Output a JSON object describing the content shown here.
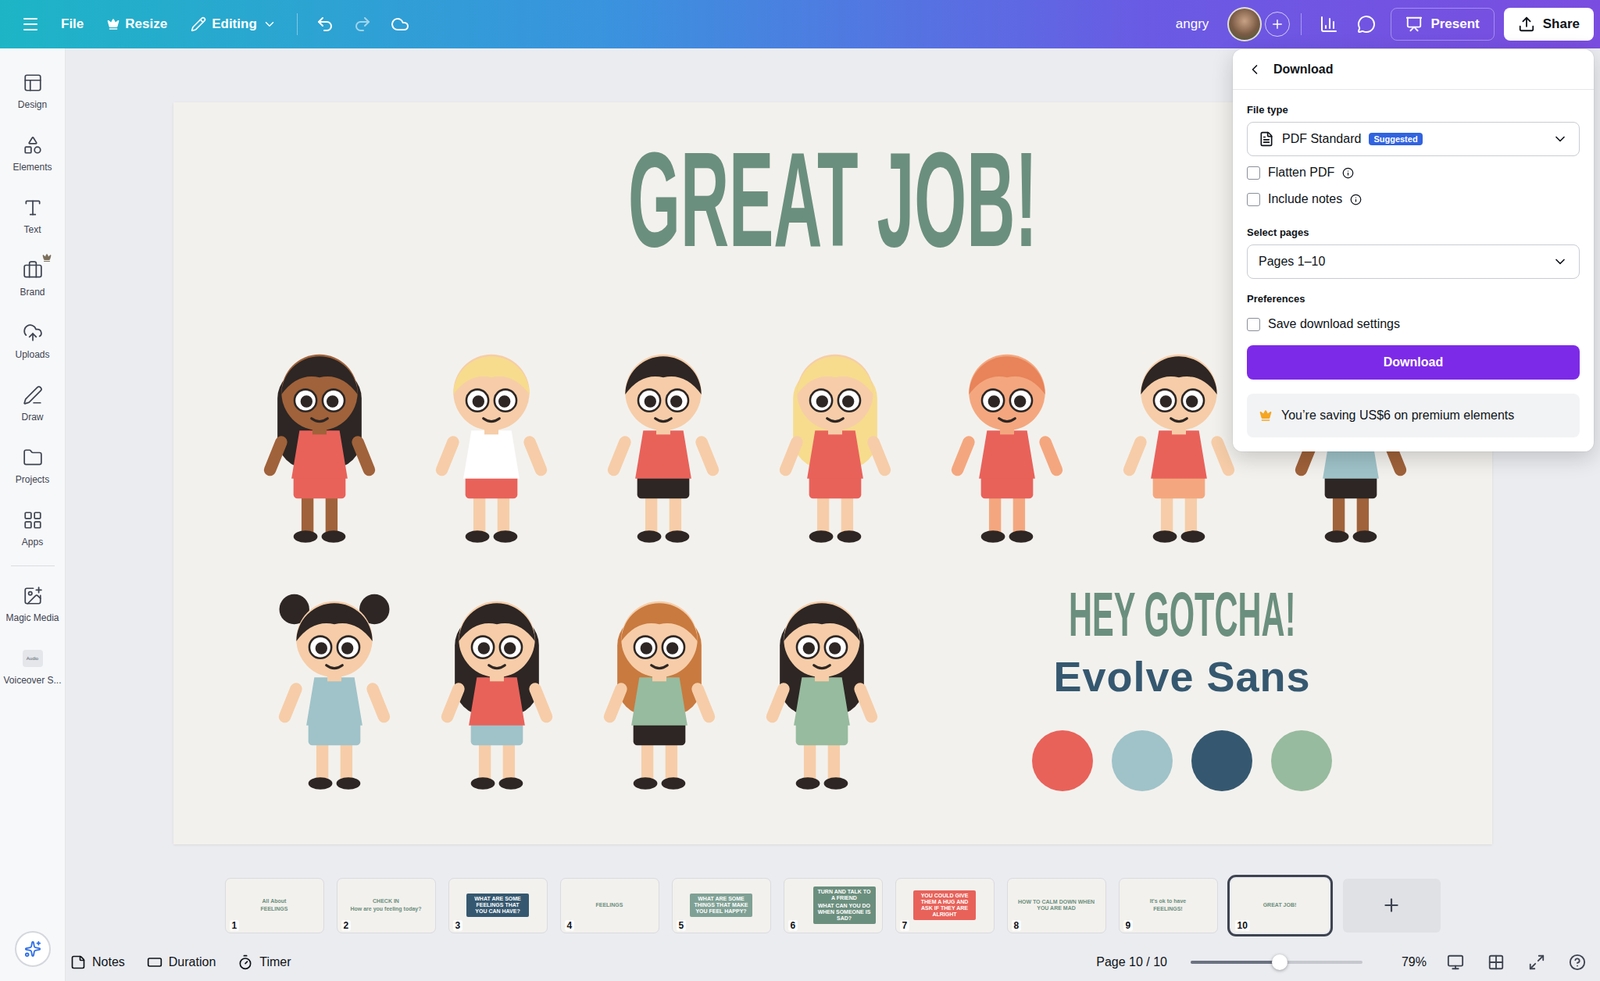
{
  "top_bar": {
    "file": "File",
    "resize": {
      "label": "Resize",
      "premium": true
    },
    "mode": "Editing",
    "title": "angry",
    "present": "Present",
    "share": "Share"
  },
  "sidebar": {
    "main": [
      {
        "label": "Design",
        "premium": false
      },
      {
        "label": "Elements",
        "premium": false
      },
      {
        "label": "Text",
        "premium": false
      },
      {
        "label": "Brand",
        "premium": true
      },
      {
        "label": "Uploads",
        "premium": false
      },
      {
        "label": "Draw",
        "premium": false
      },
      {
        "label": "Projects",
        "premium": false
      },
      {
        "label": "Apps",
        "premium": false
      }
    ],
    "extra": [
      {
        "label": "Magic Media",
        "icon_text": ""
      },
      {
        "label": "Voiceover S...",
        "icon_text": "Audio"
      }
    ]
  },
  "slide": {
    "title": "GREAT JOB!",
    "subtitle": "HEY GOTCHA!",
    "font_name": "Evolve Sans",
    "swatches": [
      {
        "color": "#e8625a"
      },
      {
        "color": "#9fc3c9"
      },
      {
        "color": "#355870"
      },
      {
        "color": "#97bb9e"
      }
    ]
  },
  "download_panel": {
    "title": "Download",
    "file_type_label": "File type",
    "file_type": "PDF Standard",
    "file_type_badge": "Suggested",
    "options": [
      {
        "label": "Flatten PDF",
        "checked": false,
        "info": true
      },
      {
        "label": "Include notes",
        "checked": false,
        "info": true
      }
    ],
    "pages_label": "Select pages",
    "pages": "Pages 1–10",
    "preferences_label": "Preferences",
    "preferences": [
      {
        "label": "Save download settings",
        "checked": false,
        "info": false
      }
    ],
    "button": "Download",
    "notice": "You’re saving US$6 on premium elements"
  },
  "thumbnails": [
    {
      "number": "1",
      "kind": "light",
      "lines": [
        "All About",
        "FEELINGS"
      ],
      "selected": false
    },
    {
      "number": "2",
      "kind": "light",
      "lines": [
        "CHECK IN",
        "How are you feeling today?"
      ],
      "selected": false
    },
    {
      "number": "3",
      "kind": "dark",
      "lines": [
        "WHAT ARE SOME FEELINGS THAT YOU CAN HAVE?"
      ],
      "selected": false
    },
    {
      "number": "4",
      "kind": "light",
      "lines": [
        "FEELINGS"
      ],
      "selected": false
    },
    {
      "number": "5",
      "kind": "green",
      "lines": [
        "WHAT ARE SOME THINGS THAT MAKE YOU FEEL HAPPY?"
      ],
      "selected": false
    },
    {
      "number": "6",
      "kind": "split",
      "lines": [
        "TURN AND TALK TO A FRIEND",
        "WHAT CAN YOU DO WHEN SOMEONE IS SAD?"
      ],
      "selected": false
    },
    {
      "number": "7",
      "kind": "red",
      "lines": [
        "YOU COULD GIVE THEM A HUG AND ASK IF THEY ARE ALRIGHT"
      ],
      "selected": false
    },
    {
      "number": "8",
      "kind": "light",
      "lines": [
        "HOW TO CALM DOWN WHEN YOU ARE MAD"
      ],
      "selected": false
    },
    {
      "number": "9",
      "kind": "light",
      "lines": [
        "It's ok to have",
        "FEELINGS!"
      ],
      "selected": false
    },
    {
      "number": "10",
      "kind": "light",
      "lines": [
        "GREAT JOB!"
      ],
      "selected": true
    }
  ],
  "footer": {
    "tools": [
      {
        "label": "Notes"
      },
      {
        "label": "Duration"
      },
      {
        "label": "Timer"
      }
    ],
    "page": "Page 10 / 10",
    "zoom": {
      "level": 0.52,
      "reading": "79%"
    }
  }
}
